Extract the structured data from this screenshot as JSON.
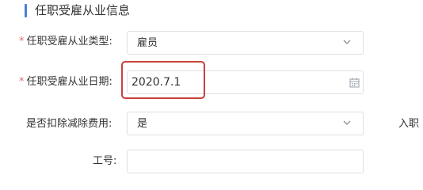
{
  "section": {
    "title": "任职受雇从业信息"
  },
  "form": {
    "employment_type": {
      "required": "*",
      "label": "任职受雇从业类型:",
      "value": "雇员"
    },
    "employment_date": {
      "required": "*",
      "label": "任职受雇从业日期:",
      "value": "2020.7.1"
    },
    "deduct_expenses": {
      "label": "是否扣除减除费用:",
      "value": "是"
    },
    "employee_no": {
      "label": "工号:",
      "value": ""
    },
    "entry_label_cut": "入职"
  },
  "colors": {
    "accent": "#4a7fd6",
    "required_star": "#e06d6d",
    "highlight_box": "#c8413d",
    "border": "#dcdfe6"
  },
  "icons": {
    "dropdown": "chevron-down-icon",
    "date": "calendar-icon"
  }
}
